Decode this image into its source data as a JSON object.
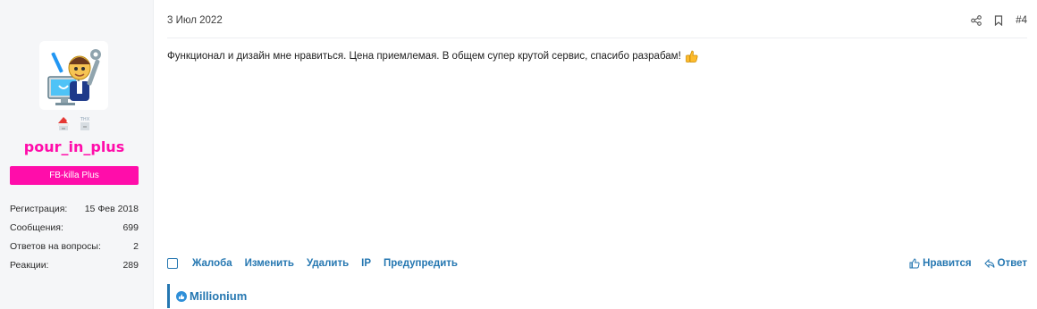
{
  "user": {
    "username": "pour_in_plus",
    "banner": "FB-killa Plus",
    "stats": [
      {
        "label": "Регистрация:",
        "value": "15 Фев 2018"
      },
      {
        "label": "Сообщения:",
        "value": "699"
      },
      {
        "label": "Ответов на вопросы:",
        "value": "2"
      },
      {
        "label": "Реакции:",
        "value": "289"
      }
    ],
    "badges": [
      "santa-hat-badge-icon",
      "thx-badge-icon"
    ],
    "thx_text": "THX"
  },
  "post": {
    "date": "3 Июл 2022",
    "number": "#4",
    "message": "Функционал и дизайн мне нравиться. Цена приемлемая. В общем супер крутой сервис, спасибо разрабам!"
  },
  "footer": {
    "report": "Жалоба",
    "edit": "Изменить",
    "delete": "Удалить",
    "ip": "IP",
    "warn": "Предупредить",
    "like": "Нравится",
    "reply": "Ответ"
  },
  "reactions": {
    "user": "Millionium"
  },
  "colors": {
    "username": "#ff0daa",
    "banner_bg": "#ff0daa",
    "link": "#2577b1",
    "sidebar_bg": "#f5f6f8"
  }
}
